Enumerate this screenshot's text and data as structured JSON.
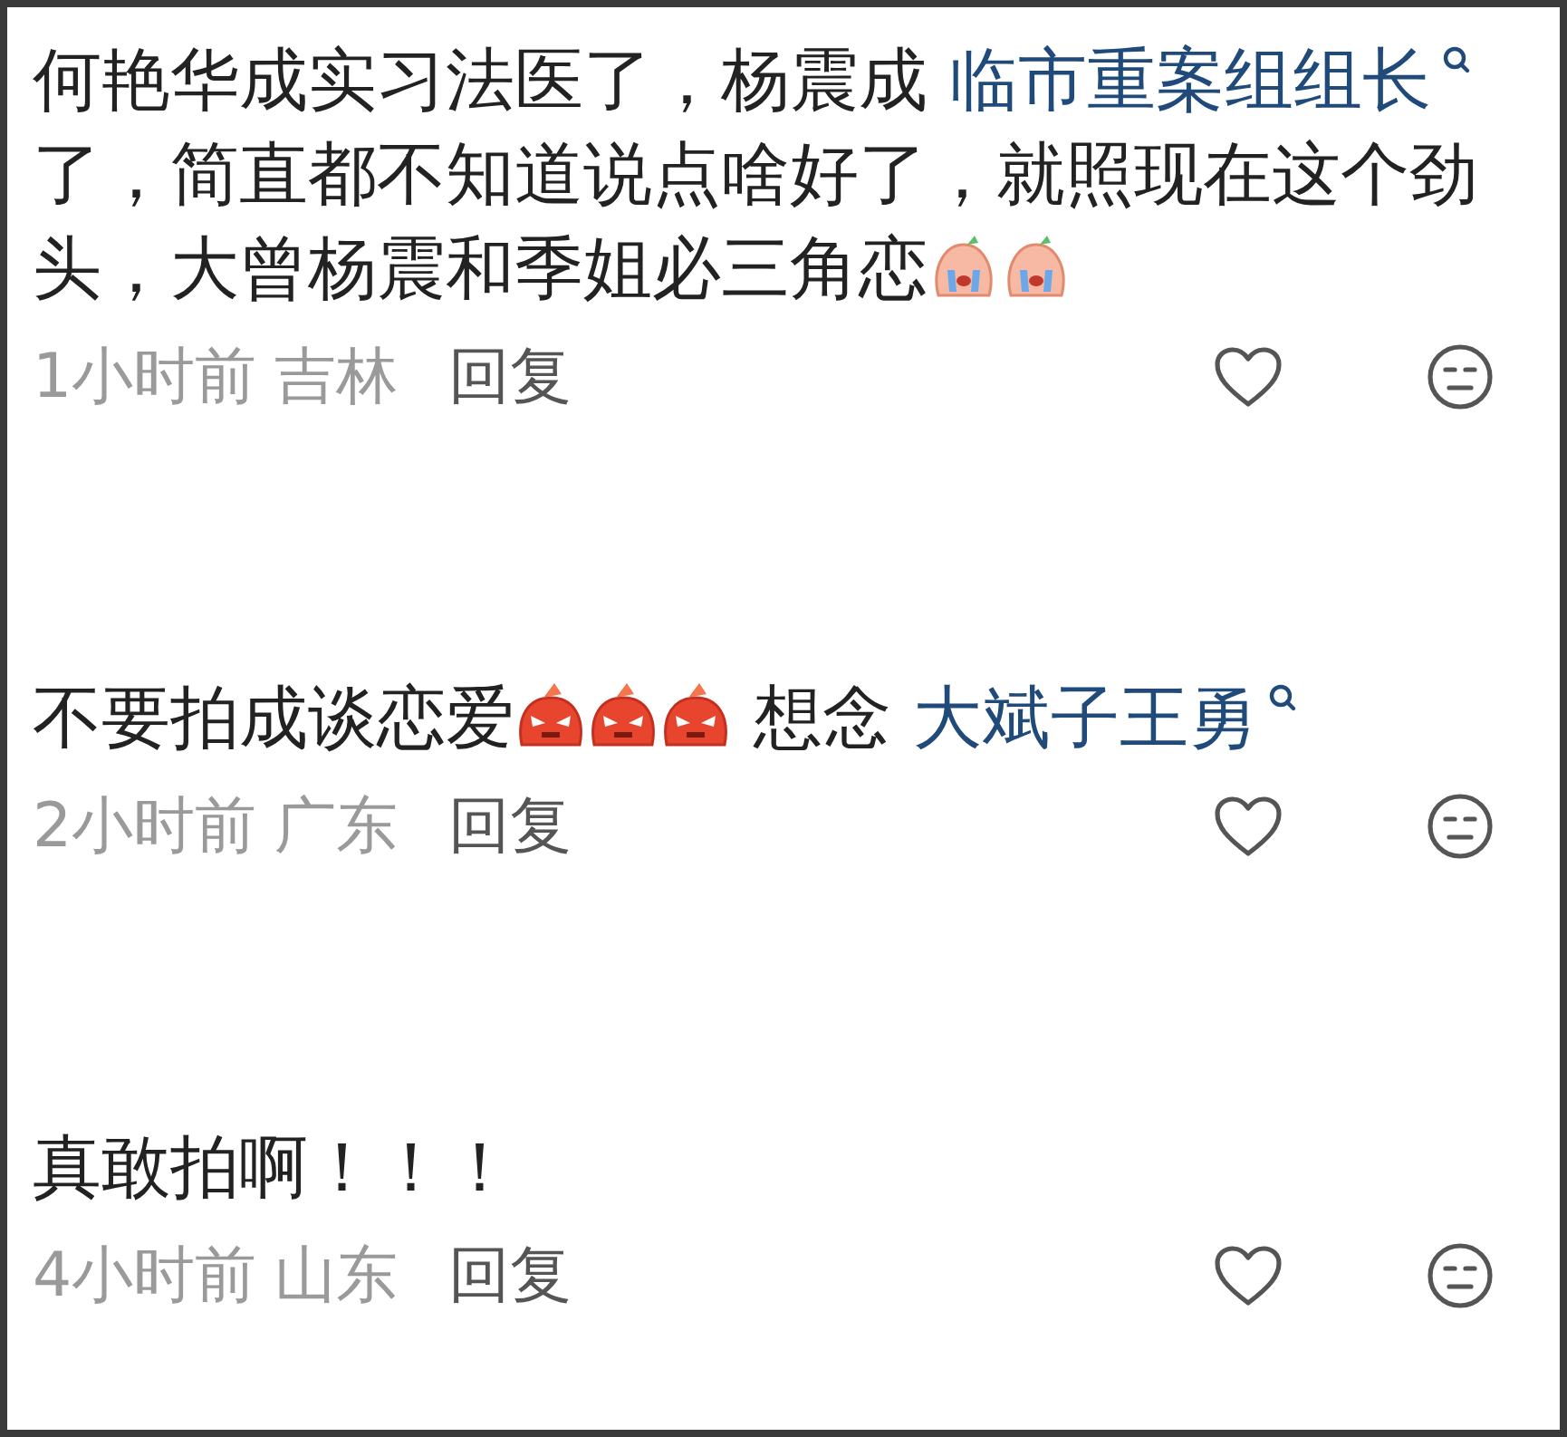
{
  "comments": [
    {
      "segments": [
        {
          "kind": "text",
          "text": "何艳华成实习法医了，杨震成 "
        },
        {
          "kind": "link",
          "text": "临市重案组组长"
        },
        {
          "kind": "text",
          "text": "了，简直都不知道说点啥好了，就照现在这个劲头，大曾杨震和季姐必三角恋"
        },
        {
          "kind": "crying"
        },
        {
          "kind": "crying"
        }
      ],
      "time": "1小时前",
      "location": "吉林",
      "reply": "回复"
    },
    {
      "segments": [
        {
          "kind": "text",
          "text": "不要拍成谈恋爱"
        },
        {
          "kind": "angry"
        },
        {
          "kind": "angry"
        },
        {
          "kind": "angry"
        },
        {
          "kind": "text",
          "text": " 想念 "
        },
        {
          "kind": "link",
          "text": "大斌子王勇"
        }
      ],
      "time": "2小时前",
      "location": "广东",
      "reply": "回复"
    },
    {
      "segments": [
        {
          "kind": "text",
          "text": "真敢拍啊！！！"
        }
      ],
      "time": "4小时前",
      "location": "山东",
      "reply": "回复"
    }
  ]
}
